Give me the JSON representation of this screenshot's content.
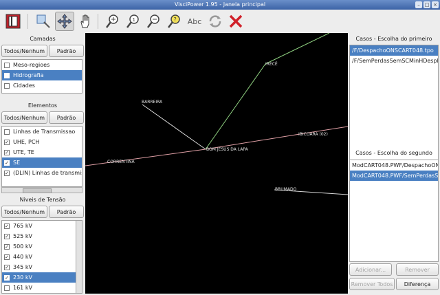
{
  "window": {
    "title": "VisciPower 1.95 - Janela principal"
  },
  "toolbar": {
    "tools": [
      {
        "name": "layers-tool-icon",
        "active": false
      },
      {
        "name": "zoom-region-tool-icon",
        "active": false
      },
      {
        "name": "move-tool-icon",
        "active": true
      },
      {
        "name": "hand-pan-tool-icon",
        "active": false
      },
      {
        "name": "zoom-in-tool-icon",
        "active": false
      },
      {
        "name": "zoom-reset-tool-icon",
        "active": false
      },
      {
        "name": "zoom-out-tool-icon",
        "active": false
      },
      {
        "name": "help-tool-icon",
        "active": false
      },
      {
        "name": "label-text-tool-icon",
        "active": false
      },
      {
        "name": "refresh-tool-icon",
        "active": false
      },
      {
        "name": "close-tool-icon",
        "active": false
      }
    ],
    "abc_label": "Abc"
  },
  "camadas": {
    "title": "Camadas",
    "all_label": "Todos/Nenhum",
    "default_label": "Padrão",
    "items": [
      {
        "label": "Meso-regioes",
        "checked": false,
        "selected": false
      },
      {
        "label": "Hidrografia",
        "checked": false,
        "selected": true
      },
      {
        "label": "Cidades",
        "checked": false,
        "selected": false
      }
    ]
  },
  "elementos": {
    "title": "Elementos",
    "all_label": "Todos/Nenhum",
    "default_label": "Padrão",
    "items": [
      {
        "label": "Linhas de Transmissao",
        "checked": false,
        "selected": false
      },
      {
        "label": "UHE, PCH",
        "checked": true,
        "selected": false
      },
      {
        "label": "UTE, TE",
        "checked": true,
        "selected": false
      },
      {
        "label": "SE",
        "checked": true,
        "selected": true
      },
      {
        "label": "(DLIN) Linhas de transmis",
        "checked": true,
        "selected": false
      }
    ]
  },
  "niveis": {
    "title": "Niveis de Tensão",
    "all_label": "Todos/Nenhum",
    "default_label": "Padrão",
    "items": [
      {
        "label": "765 kV",
        "checked": true,
        "selected": false
      },
      {
        "label": "525 kV",
        "checked": true,
        "selected": false
      },
      {
        "label": "500 kV",
        "checked": true,
        "selected": false
      },
      {
        "label": "440 kV",
        "checked": true,
        "selected": false
      },
      {
        "label": "345 kV",
        "checked": true,
        "selected": false
      },
      {
        "label": "230 kV",
        "checked": true,
        "selected": true
      },
      {
        "label": "161 kV",
        "checked": false,
        "selected": false
      }
    ]
  },
  "map": {
    "labels": [
      "IRECÊ",
      "BARREIRA",
      "IBICOARA (02)",
      "BOM JESUS DA LAPA",
      "CORRENTINA",
      "BRUMADO"
    ]
  },
  "casos1": {
    "title": "Casos - Escolha do primeiro",
    "items": [
      {
        "label": "/F/DespachoONSCART048.tpo",
        "selected": true
      },
      {
        "label": "/F/SemPerdasSemSCMinHDespF",
        "selected": false
      }
    ]
  },
  "casos2": {
    "title": "Casos - Escolha do segundo",
    "items": [
      {
        "label": "ModCART048.PWF/DespachoON",
        "selected": false
      },
      {
        "label": "ModCART048.PWF/SemPerdasS",
        "selected": true
      }
    ]
  },
  "actions": {
    "adicionar": "Adicionar...",
    "remover": "Remover",
    "remover_todos": "Remover Todos",
    "diferenca": "Diferença"
  },
  "colors": {
    "accent": "#4a80c2",
    "map_bg": "#000000"
  }
}
